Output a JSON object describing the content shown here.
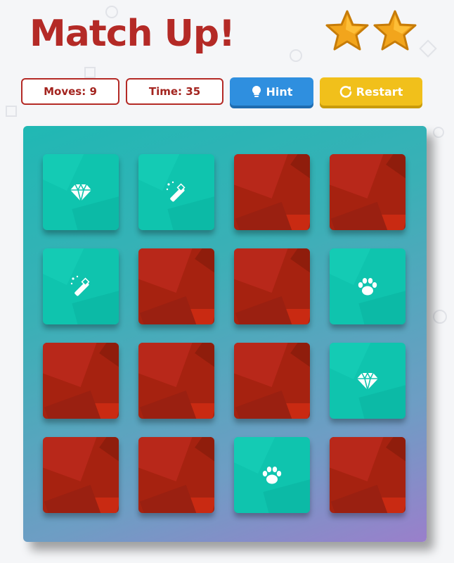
{
  "title": "Match Up!",
  "rating": {
    "stars": 2
  },
  "stats": {
    "moves": "Moves: 9",
    "time": "Time: 35"
  },
  "buttons": {
    "hint": "Hint",
    "restart": "Restart"
  },
  "colors": {
    "title": "#b42a26",
    "card_back": "#a62210",
    "card_face": "#0fc4ae",
    "hint": "#2f8fdf",
    "restart": "#f1c01b"
  },
  "board": {
    "rows": 4,
    "cols": 4,
    "cards": [
      {
        "state": "up",
        "icon": "diamond"
      },
      {
        "state": "up",
        "icon": "magic-wand"
      },
      {
        "state": "down",
        "icon": ""
      },
      {
        "state": "down",
        "icon": ""
      },
      {
        "state": "up",
        "icon": "magic-wand"
      },
      {
        "state": "down",
        "icon": ""
      },
      {
        "state": "down",
        "icon": ""
      },
      {
        "state": "up",
        "icon": "paw"
      },
      {
        "state": "down",
        "icon": ""
      },
      {
        "state": "down",
        "icon": ""
      },
      {
        "state": "down",
        "icon": ""
      },
      {
        "state": "up",
        "icon": "diamond"
      },
      {
        "state": "down",
        "icon": ""
      },
      {
        "state": "down",
        "icon": ""
      },
      {
        "state": "up",
        "icon": "paw"
      },
      {
        "state": "down",
        "icon": ""
      }
    ]
  }
}
